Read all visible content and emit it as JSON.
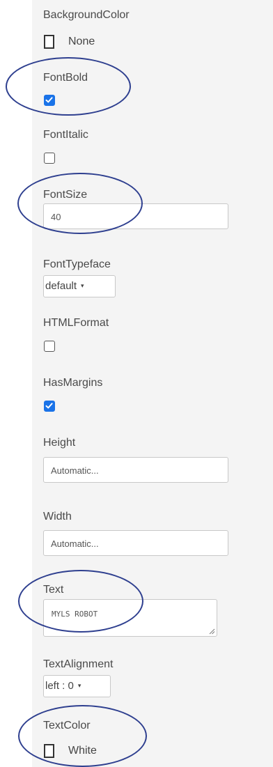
{
  "properties": {
    "background_color": {
      "label": "BackgroundColor",
      "value": "None"
    },
    "font_bold": {
      "label": "FontBold",
      "checked": true
    },
    "font_italic": {
      "label": "FontItalic",
      "checked": false
    },
    "font_size": {
      "label": "FontSize",
      "value": "40"
    },
    "font_typeface": {
      "label": "FontTypeface",
      "value": "default"
    },
    "html_format": {
      "label": "HTMLFormat",
      "checked": false
    },
    "has_margins": {
      "label": "HasMargins",
      "checked": true
    },
    "height": {
      "label": "Height",
      "value": "Automatic..."
    },
    "width": {
      "label": "Width",
      "value": "Automatic..."
    },
    "text": {
      "label": "Text",
      "value": "MYLS ROBOT"
    },
    "text_alignment": {
      "label": "TextAlignment",
      "value": "left : 0"
    },
    "text_color": {
      "label": "TextColor",
      "value": "White"
    }
  },
  "colors": {
    "panel_background": "#f4f4f4",
    "checkbox_checked": "#1a73e8",
    "highlight_circle": "#2e3f8f"
  },
  "icons": {
    "dropdown_caret": "▾",
    "checkmark": "check-icon"
  }
}
